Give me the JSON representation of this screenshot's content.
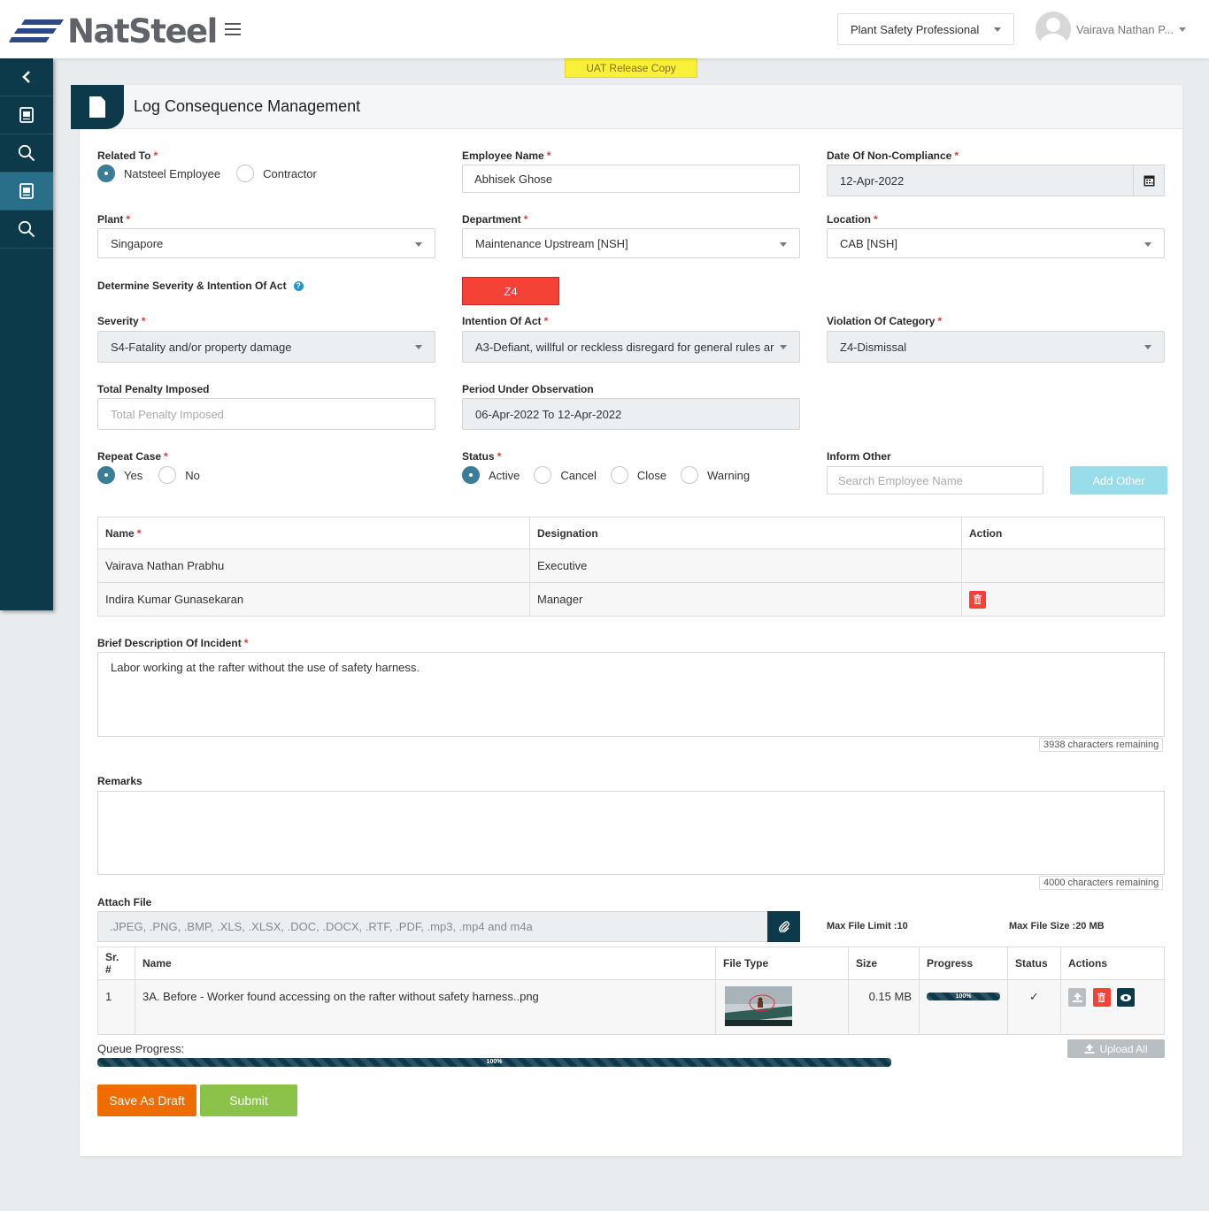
{
  "header": {
    "logo_text": "NatSteel",
    "role": "Plant Safety Professional",
    "user_name": "Vairava Nathan P...",
    "banner": "UAT Release Copy"
  },
  "sidebar": {
    "items": [
      {
        "icon": "chevron-left-icon"
      },
      {
        "icon": "document-icon"
      },
      {
        "icon": "search-icon"
      },
      {
        "icon": "document-icon",
        "active": true
      },
      {
        "icon": "search-icon"
      }
    ]
  },
  "page": {
    "title": "Log Consequence Management"
  },
  "form": {
    "related_to": {
      "label": "Related To",
      "options": [
        "Natsteel Employee",
        "Contractor"
      ],
      "selected": "Natsteel Employee"
    },
    "employee_name": {
      "label": "Employee Name",
      "value": "Abhisek   Ghose"
    },
    "date_non_compliance": {
      "label": "Date Of Non-Compliance",
      "value": "12-Apr-2022"
    },
    "plant": {
      "label": "Plant",
      "value": "Singapore"
    },
    "department": {
      "label": "Department",
      "value": "Maintenance Upstream [NSH]"
    },
    "location": {
      "label": "Location",
      "value": "CAB [NSH]"
    },
    "determine": {
      "label": "Determine Severity & Intention Of Act",
      "result": "Z4"
    },
    "severity": {
      "label": "Severity",
      "value": "S4-Fatality and/or property damage"
    },
    "intention": {
      "label": "Intention Of Act",
      "value": "A3-Defiant, willful or reckless disregard for general rules ar"
    },
    "violation": {
      "label": "Violation Of Category",
      "value": "Z4-Dismissal"
    },
    "penalty": {
      "label": "Total Penalty Imposed",
      "placeholder": "Total Penalty Imposed"
    },
    "period": {
      "label": "Period Under Observation",
      "value": "06-Apr-2022 To 12-Apr-2022"
    },
    "repeat_case": {
      "label": "Repeat Case",
      "options": [
        "Yes",
        "No"
      ],
      "selected": "Yes"
    },
    "status": {
      "label": "Status",
      "options": [
        "Active",
        "Cancel",
        "Close",
        "Warning"
      ],
      "selected": "Active"
    },
    "inform_other": {
      "label": "Inform Other",
      "placeholder": "Search Employee Name",
      "button": "Add Other"
    },
    "inform_table": {
      "headers": [
        "Name",
        "Designation",
        "Action"
      ],
      "rows": [
        {
          "name": "Vairava Nathan Prabhu",
          "designation": "Executive",
          "deletable": false
        },
        {
          "name": "Indira Kumar Gunasekaran",
          "designation": "Manager",
          "deletable": true
        }
      ]
    },
    "description": {
      "label": "Brief Description Of Incident",
      "value": "Labor working at the rafter without the use of safety harness.",
      "remaining": "3938 characters remaining"
    },
    "remarks": {
      "label": "Remarks",
      "value": "",
      "remaining": "4000 characters remaining"
    },
    "attach": {
      "label": "Attach File",
      "types": ".JPEG, .PNG, .BMP, .XLS, .XLSX, .DOC, .DOCX, .RTF, .PDF, .mp3, .mp4 and m4a",
      "max_limit": "Max File Limit :10",
      "max_size": "Max File Size :20 MB"
    },
    "files_table": {
      "headers": [
        "Sr. #",
        "Name",
        "File Type",
        "Size",
        "Progress",
        "Status",
        "Actions"
      ],
      "rows": [
        {
          "sr": "1",
          "name": "3A. Before - Worker found accessing on the rafter without safety harness..png",
          "size": "0.15 MB",
          "progress": 100,
          "progress_label": "100%",
          "status": "✓"
        }
      ]
    },
    "queue": {
      "label": "Queue Progress:",
      "progress": 100,
      "progress_label": "100%"
    },
    "upload_all": "Upload All",
    "save_draft": "Save As Draft",
    "submit": "Submit"
  },
  "colors": {
    "primary_dark": "#0d3a4a",
    "accent": "#3a7d98",
    "danger": "#f44336",
    "draft": "#ef6c00",
    "submit": "#8bc34a",
    "banner": "#f9f03a"
  }
}
